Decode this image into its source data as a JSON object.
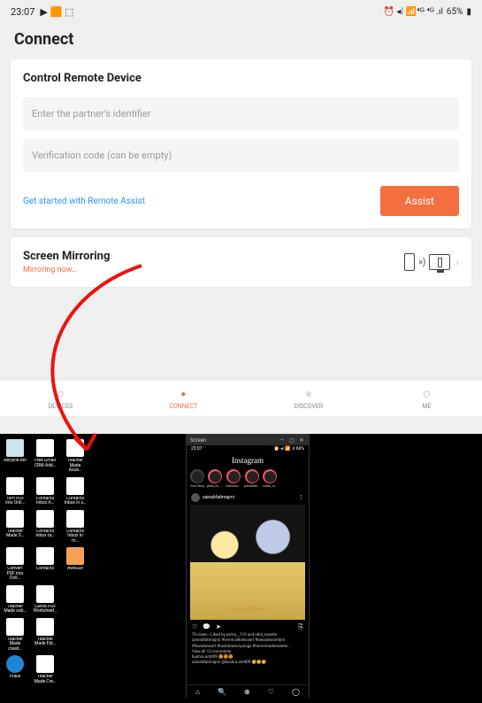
{
  "status": {
    "time": "23:07",
    "battery": "65%",
    "indicators": "⏰ ◂⁞ 📶⁴ᴳ ⁴ᴳ .ıl"
  },
  "page_title": "Connect",
  "control": {
    "title": "Control Remote Device",
    "identifier_placeholder": "Enter the partner's identifier",
    "code_placeholder": "Verification code (can be empty)",
    "link_text": "Get started with Remote Assist",
    "button_label": "Assist"
  },
  "mirror": {
    "title": "Screen Mirroring",
    "status": "Mirroring now…"
  },
  "nav": {
    "items": [
      {
        "label": "DEVICES",
        "icon": "▢"
      },
      {
        "label": "CONNECT",
        "icon": "◆"
      },
      {
        "label": "DISCOVER",
        "icon": "◎"
      },
      {
        "label": "ME",
        "icon": "◯"
      }
    ],
    "active": 1
  },
  "desktop": {
    "icons": [
      [
        "Recycle Bin",
        "Free Gmail CRM Add…",
        "Teacher Made Asse…"
      ],
      [
        "Turn PDF into Onli…",
        "Contacts Inbox A…",
        "Contacts Inbox in s…"
      ],
      [
        "Teacher Made S…",
        "Contacts Inbox ta…",
        "Contacts Inbox in m…"
      ],
      [
        "Convert PDF into Onli…",
        "Contacts",
        "AweSun"
      ],
      [
        "Teacher Made sub…",
        "Canva PDF Worksheet…"
      ],
      [
        "Teacher Made creati…",
        "Teacher Made Edi…"
      ],
      [
        "Publii",
        "Teacher Made Cre…"
      ]
    ]
  },
  "scrcpy": {
    "window_title": "Screen",
    "status": {
      "time": "23:07",
      "right": "⏰ ◂⁞ 📶 .ıl 66%"
    },
    "app_name": "Instagram",
    "stories": [
      "Your Story",
      "pâtis_ch_t…",
      "shahreen_pa…",
      "pastelbakes…",
      "indian_m…"
    ],
    "post": {
      "user": "zainabfatimajmi",
      "caption": "Custard Rabri",
      "likes_line": "70 views • Liked by azma__110 and rabii_sweets",
      "caption_line": "zainabfatimajmi #vermicellidessert #rawadessertjmi #ilovedessert #rackdowncryoings #homemadesweets …",
      "viewall": "View all 13 comments",
      "comment1": "bushra.ant409 😍😍😍",
      "comment2": "zainabfatimajmi @bushra.ant409 😘😘😘"
    }
  }
}
